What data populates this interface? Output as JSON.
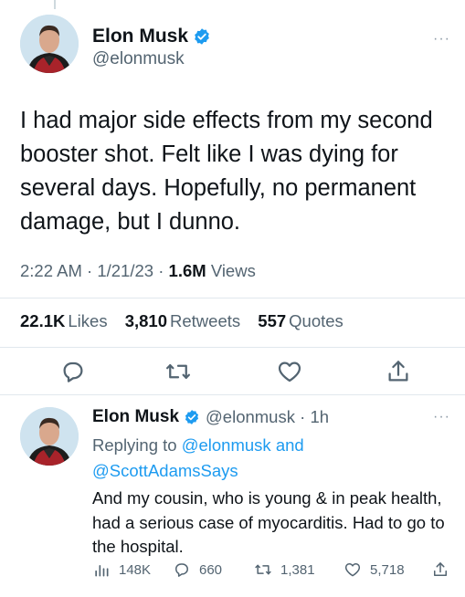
{
  "tweet": {
    "author_name": "Elon Musk",
    "author_handle": "@elonmusk",
    "text": "I had major side effects from my second booster shot. Felt like I was dying for several days. Hopefully, no permanent damage, but I dunno.",
    "time": "2:22 AM",
    "date": "1/21/23",
    "views_count": "1.6M",
    "views_label": "Views",
    "likes_count": "22.1K",
    "likes_label": "Likes",
    "retweets_count": "3,810",
    "retweets_label": "Retweets",
    "quotes_count": "557",
    "quotes_label": "Quotes",
    "more_icon": "···"
  },
  "reply": {
    "author_name": "Elon Musk",
    "author_handle": "@elonmusk",
    "age": "1h",
    "replying_prefix": "Replying to",
    "replying_user_1": "@elonmusk",
    "replying_and": "and",
    "replying_user_2": "@ScottAdamsSays",
    "text": "And my cousin, who is young & in peak health, had a serious case of myocarditis. Had to go to the hospital.",
    "views": "148K",
    "replies": "660",
    "retweets": "1,381",
    "likes": "5,718",
    "more_icon": "···"
  },
  "colors": {
    "accent": "#1d9bf0",
    "secondary_text": "#536471",
    "primary_text": "#0f1419",
    "divider": "#e1e8ed"
  },
  "icons": [
    "verified-badge-icon",
    "more-icon",
    "reply-icon",
    "retweet-icon",
    "like-icon",
    "share-icon",
    "views-icon"
  ]
}
